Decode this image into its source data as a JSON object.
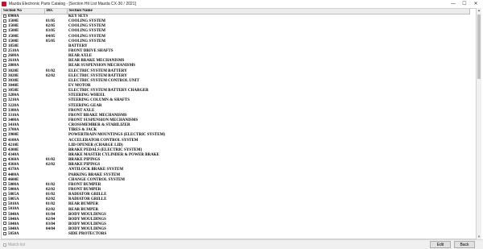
{
  "window": {
    "title": "Mazda Electronic Parts Catalog - [Section Hit List Mazda CX-30 / 2021]",
    "minimize": "—",
    "maximize": "☐",
    "close": "✕"
  },
  "table": {
    "headers": [
      "Section No",
      "Div.",
      "Section Name"
    ],
    "rows": [
      {
        "section": "0900A",
        "div": "",
        "name": "KEY SETS"
      },
      {
        "section": "1500E",
        "div": "01/05",
        "name": "COOLING SYSTEM"
      },
      {
        "section": "1500E",
        "div": "02/05",
        "name": "COOLING SYSTEM"
      },
      {
        "section": "1500E",
        "div": "03/05",
        "name": "COOLING SYSTEM"
      },
      {
        "section": "1500E",
        "div": "04/05",
        "name": "COOLING SYSTEM"
      },
      {
        "section": "1500E",
        "div": "05/05",
        "name": "COOLING SYSTEM"
      },
      {
        "section": "1850E",
        "div": "",
        "name": "BATTERY"
      },
      {
        "section": "2510A",
        "div": "",
        "name": "FRONT DRIVE SHAFTS"
      },
      {
        "section": "2600A",
        "div": "",
        "name": "REAR AXLE"
      },
      {
        "section": "2610A",
        "div": "",
        "name": "REAR BRAKE MECHANISMS"
      },
      {
        "section": "2800A",
        "div": "",
        "name": "REAR SUSPENSION MECHANISMS"
      },
      {
        "section": "3020E",
        "div": "01/02",
        "name": "ELECTRIC SYSTEM BATTERY"
      },
      {
        "section": "3020E",
        "div": "02/02",
        "name": "ELECTRIC SYSTEM BATTERY"
      },
      {
        "section": "3030E",
        "div": "",
        "name": "ELECTRIC SYSTEM CONTROL UNIT"
      },
      {
        "section": "3040E",
        "div": "",
        "name": "EV MOTOR"
      },
      {
        "section": "3050E",
        "div": "",
        "name": "ELECTRIC SYSTEM BATTERY CHARGER"
      },
      {
        "section": "3200A",
        "div": "",
        "name": "STEERING WHEEL"
      },
      {
        "section": "3210A",
        "div": "",
        "name": "STEERING COLUMN & SHAFTS"
      },
      {
        "section": "3220A",
        "div": "",
        "name": "STEERING GEAR"
      },
      {
        "section": "3300A",
        "div": "",
        "name": "FRONT AXLE"
      },
      {
        "section": "3310A",
        "div": "",
        "name": "FRONT BRAKE MECHANISMS"
      },
      {
        "section": "3400A",
        "div": "",
        "name": "FRONT SUSPENSION MECHANISMS"
      },
      {
        "section": "3410A",
        "div": "",
        "name": "CROSSMEMBER & STABILIZER"
      },
      {
        "section": "3700A",
        "div": "",
        "name": "TIRES & JACK"
      },
      {
        "section": "3900E",
        "div": "",
        "name": "POWERTRAIN MOUNTINGS (ELECTRIC SYSTEM)"
      },
      {
        "section": "4100A",
        "div": "",
        "name": "ACCELERATOR CONTROL SYSTEM"
      },
      {
        "section": "4210E",
        "div": "",
        "name": "LID OPENER (CHARGE LID)"
      },
      {
        "section": "4300E",
        "div": "",
        "name": "BRAKE PEDALS (ELECTRIC SYSTEM)"
      },
      {
        "section": "4340A",
        "div": "",
        "name": "BRAKE MASTER CYLINDER & POWER BRAKE"
      },
      {
        "section": "4360A",
        "div": "01/02",
        "name": "BRAKE PIPINGS"
      },
      {
        "section": "4360A",
        "div": "02/02",
        "name": "BRAKE PIPINGS"
      },
      {
        "section": "4370A",
        "div": "",
        "name": "ANTILOCK BRAKE SYSTEM"
      },
      {
        "section": "4400A",
        "div": "",
        "name": "PARKING BRAKE SYSTEM"
      },
      {
        "section": "4600E",
        "div": "",
        "name": "CHANGE CONTROL SYSTEM"
      },
      {
        "section": "5000A",
        "div": "01/02",
        "name": "FRONT BUMPER"
      },
      {
        "section": "5000A",
        "div": "02/02",
        "name": "FRONT BUMPER"
      },
      {
        "section": "5005A",
        "div": "01/02",
        "name": "RADIATOR GRILLE"
      },
      {
        "section": "5005A",
        "div": "02/02",
        "name": "RADIATOR GRILLE"
      },
      {
        "section": "5010A",
        "div": "01/02",
        "name": "REAR BUMPER"
      },
      {
        "section": "5010A",
        "div": "02/02",
        "name": "REAR BUMPER"
      },
      {
        "section": "5040A",
        "div": "01/04",
        "name": "BODY MOULDINGS"
      },
      {
        "section": "5040A",
        "div": "02/04",
        "name": "BODY MOULDINGS"
      },
      {
        "section": "5040A",
        "div": "03/04",
        "name": "BODY MOULDINGS"
      },
      {
        "section": "5040A",
        "div": "04/04",
        "name": "BODY MOULDINGS"
      },
      {
        "section": "5050A",
        "div": "",
        "name": "SIDE PROTECTORS"
      }
    ]
  },
  "footer": {
    "match_label": "Match list",
    "edit_label": "Edit",
    "back_label": "Back"
  }
}
